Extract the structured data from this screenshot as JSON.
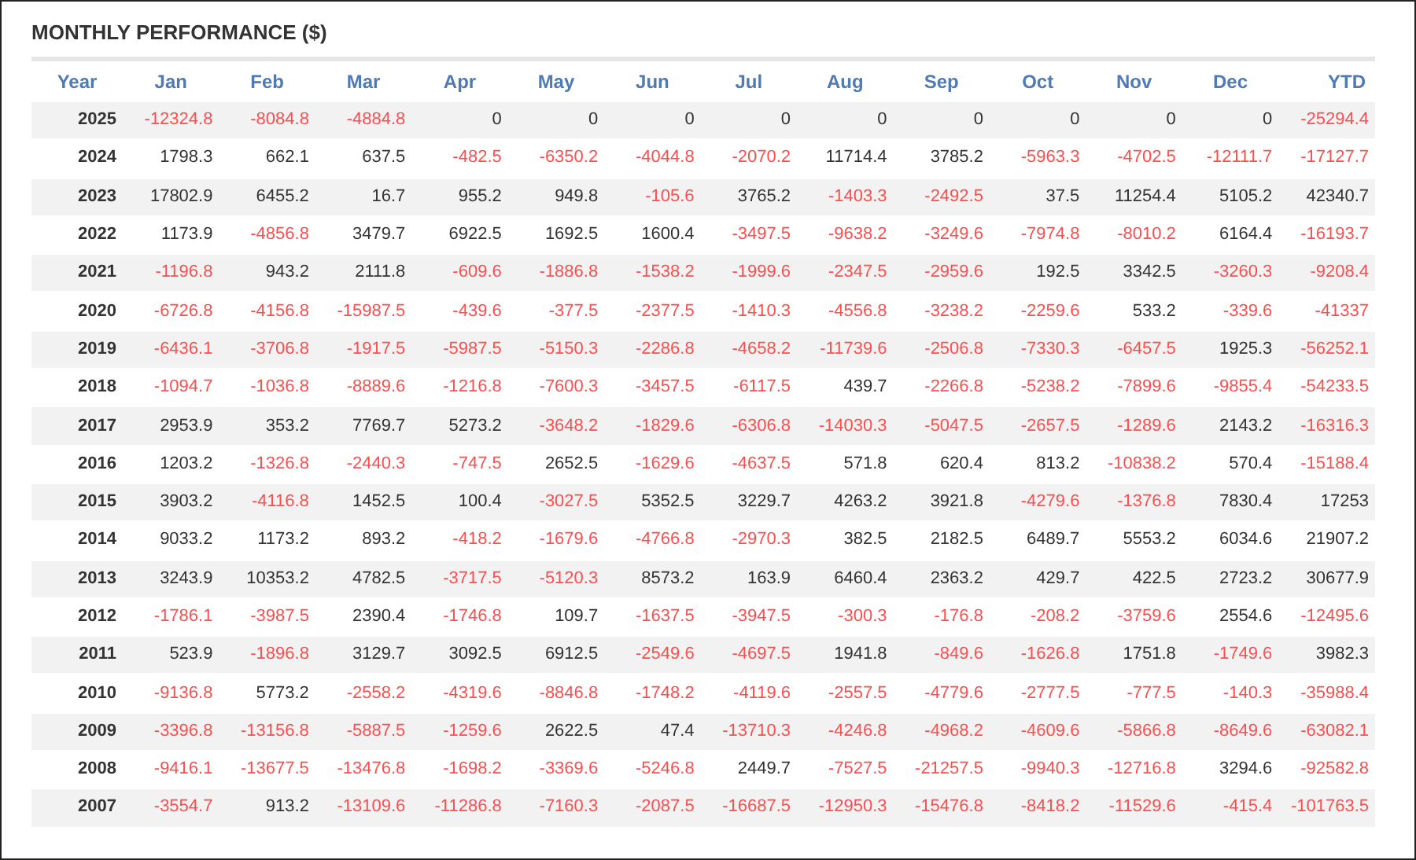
{
  "title": "MONTHLY PERFORMANCE ($)",
  "columns": [
    "Year",
    "Jan",
    "Feb",
    "Mar",
    "Apr",
    "May",
    "Jun",
    "Jul",
    "Aug",
    "Sep",
    "Oct",
    "Nov",
    "Dec",
    "YTD"
  ],
  "rows": [
    {
      "year": "2025",
      "cells": [
        {
          "value": "-12324.8",
          "negative": true
        },
        {
          "value": "-8084.8",
          "negative": true
        },
        {
          "value": "-4884.8",
          "negative": true
        },
        {
          "value": "0",
          "negative": false
        },
        {
          "value": "0",
          "negative": false
        },
        {
          "value": "0",
          "negative": false
        },
        {
          "value": "0",
          "negative": false
        },
        {
          "value": "0",
          "negative": false
        },
        {
          "value": "0",
          "negative": false
        },
        {
          "value": "0",
          "negative": false
        },
        {
          "value": "0",
          "negative": false
        },
        {
          "value": "0",
          "negative": false
        },
        {
          "value": "-25294.4",
          "negative": true
        }
      ]
    },
    {
      "year": "2024",
      "cells": [
        {
          "value": "1798.3",
          "negative": false
        },
        {
          "value": "662.1",
          "negative": false
        },
        {
          "value": "637.5",
          "negative": false
        },
        {
          "value": "-482.5",
          "negative": true
        },
        {
          "value": "-6350.2",
          "negative": true
        },
        {
          "value": "-4044.8",
          "negative": true
        },
        {
          "value": "-2070.2",
          "negative": true
        },
        {
          "value": "11714.4",
          "negative": false
        },
        {
          "value": "3785.2",
          "negative": false
        },
        {
          "value": "-5963.3",
          "negative": true
        },
        {
          "value": "-4702.5",
          "negative": true
        },
        {
          "value": "-12111.7",
          "negative": true
        },
        {
          "value": "-17127.7",
          "negative": true
        }
      ]
    },
    {
      "year": "2023",
      "cells": [
        {
          "value": "17802.9",
          "negative": false
        },
        {
          "value": "6455.2",
          "negative": false
        },
        {
          "value": "16.7",
          "negative": false
        },
        {
          "value": "955.2",
          "negative": false
        },
        {
          "value": "949.8",
          "negative": false
        },
        {
          "value": "-105.6",
          "negative": true
        },
        {
          "value": "3765.2",
          "negative": false
        },
        {
          "value": "-1403.3",
          "negative": true
        },
        {
          "value": "-2492.5",
          "negative": true
        },
        {
          "value": "37.5",
          "negative": false
        },
        {
          "value": "11254.4",
          "negative": false
        },
        {
          "value": "5105.2",
          "negative": false
        },
        {
          "value": "42340.7",
          "negative": false
        }
      ]
    },
    {
      "year": "2022",
      "cells": [
        {
          "value": "1173.9",
          "negative": false
        },
        {
          "value": "-4856.8",
          "negative": true
        },
        {
          "value": "3479.7",
          "negative": false
        },
        {
          "value": "6922.5",
          "negative": false
        },
        {
          "value": "1692.5",
          "negative": false
        },
        {
          "value": "1600.4",
          "negative": false
        },
        {
          "value": "-3497.5",
          "negative": true
        },
        {
          "value": "-9638.2",
          "negative": true
        },
        {
          "value": "-3249.6",
          "negative": true
        },
        {
          "value": "-7974.8",
          "negative": true
        },
        {
          "value": "-8010.2",
          "negative": true
        },
        {
          "value": "6164.4",
          "negative": false
        },
        {
          "value": "-16193.7",
          "negative": true
        }
      ]
    },
    {
      "year": "2021",
      "cells": [
        {
          "value": "-1196.8",
          "negative": true
        },
        {
          "value": "943.2",
          "negative": false
        },
        {
          "value": "2111.8",
          "negative": false
        },
        {
          "value": "-609.6",
          "negative": true
        },
        {
          "value": "-1886.8",
          "negative": true
        },
        {
          "value": "-1538.2",
          "negative": true
        },
        {
          "value": "-1999.6",
          "negative": true
        },
        {
          "value": "-2347.5",
          "negative": true
        },
        {
          "value": "-2959.6",
          "negative": true
        },
        {
          "value": "192.5",
          "negative": false
        },
        {
          "value": "3342.5",
          "negative": false
        },
        {
          "value": "-3260.3",
          "negative": true
        },
        {
          "value": "-9208.4",
          "negative": true
        }
      ]
    },
    {
      "year": "2020",
      "cells": [
        {
          "value": "-6726.8",
          "negative": true
        },
        {
          "value": "-4156.8",
          "negative": true
        },
        {
          "value": "-15987.5",
          "negative": true
        },
        {
          "value": "-439.6",
          "negative": true
        },
        {
          "value": "-377.5",
          "negative": true
        },
        {
          "value": "-2377.5",
          "negative": true
        },
        {
          "value": "-1410.3",
          "negative": true
        },
        {
          "value": "-4556.8",
          "negative": true
        },
        {
          "value": "-3238.2",
          "negative": true
        },
        {
          "value": "-2259.6",
          "negative": true
        },
        {
          "value": "533.2",
          "negative": false
        },
        {
          "value": "-339.6",
          "negative": true
        },
        {
          "value": "-41337",
          "negative": true
        }
      ]
    },
    {
      "year": "2019",
      "cells": [
        {
          "value": "-6436.1",
          "negative": true
        },
        {
          "value": "-3706.8",
          "negative": true
        },
        {
          "value": "-1917.5",
          "negative": true
        },
        {
          "value": "-5987.5",
          "negative": true
        },
        {
          "value": "-5150.3",
          "negative": true
        },
        {
          "value": "-2286.8",
          "negative": true
        },
        {
          "value": "-4658.2",
          "negative": true
        },
        {
          "value": "-11739.6",
          "negative": true
        },
        {
          "value": "-2506.8",
          "negative": true
        },
        {
          "value": "-7330.3",
          "negative": true
        },
        {
          "value": "-6457.5",
          "negative": true
        },
        {
          "value": "1925.3",
          "negative": false
        },
        {
          "value": "-56252.1",
          "negative": true
        }
      ]
    },
    {
      "year": "2018",
      "cells": [
        {
          "value": "-1094.7",
          "negative": true
        },
        {
          "value": "-1036.8",
          "negative": true
        },
        {
          "value": "-8889.6",
          "negative": true
        },
        {
          "value": "-1216.8",
          "negative": true
        },
        {
          "value": "-7600.3",
          "negative": true
        },
        {
          "value": "-3457.5",
          "negative": true
        },
        {
          "value": "-6117.5",
          "negative": true
        },
        {
          "value": "439.7",
          "negative": false
        },
        {
          "value": "-2266.8",
          "negative": true
        },
        {
          "value": "-5238.2",
          "negative": true
        },
        {
          "value": "-7899.6",
          "negative": true
        },
        {
          "value": "-9855.4",
          "negative": true
        },
        {
          "value": "-54233.5",
          "negative": true
        }
      ]
    },
    {
      "year": "2017",
      "cells": [
        {
          "value": "2953.9",
          "negative": false
        },
        {
          "value": "353.2",
          "negative": false
        },
        {
          "value": "7769.7",
          "negative": false
        },
        {
          "value": "5273.2",
          "negative": false
        },
        {
          "value": "-3648.2",
          "negative": true
        },
        {
          "value": "-1829.6",
          "negative": true
        },
        {
          "value": "-6306.8",
          "negative": true
        },
        {
          "value": "-14030.3",
          "negative": true
        },
        {
          "value": "-5047.5",
          "negative": true
        },
        {
          "value": "-2657.5",
          "negative": true
        },
        {
          "value": "-1289.6",
          "negative": true
        },
        {
          "value": "2143.2",
          "negative": false
        },
        {
          "value": "-16316.3",
          "negative": true
        }
      ]
    },
    {
      "year": "2016",
      "cells": [
        {
          "value": "1203.2",
          "negative": false
        },
        {
          "value": "-1326.8",
          "negative": true
        },
        {
          "value": "-2440.3",
          "negative": true
        },
        {
          "value": "-747.5",
          "negative": true
        },
        {
          "value": "2652.5",
          "negative": false
        },
        {
          "value": "-1629.6",
          "negative": true
        },
        {
          "value": "-4637.5",
          "negative": true
        },
        {
          "value": "571.8",
          "negative": false
        },
        {
          "value": "620.4",
          "negative": false
        },
        {
          "value": "813.2",
          "negative": false
        },
        {
          "value": "-10838.2",
          "negative": true
        },
        {
          "value": "570.4",
          "negative": false
        },
        {
          "value": "-15188.4",
          "negative": true
        }
      ]
    },
    {
      "year": "2015",
      "cells": [
        {
          "value": "3903.2",
          "negative": false
        },
        {
          "value": "-4116.8",
          "negative": true
        },
        {
          "value": "1452.5",
          "negative": false
        },
        {
          "value": "100.4",
          "negative": false
        },
        {
          "value": "-3027.5",
          "negative": true
        },
        {
          "value": "5352.5",
          "negative": false
        },
        {
          "value": "3229.7",
          "negative": false
        },
        {
          "value": "4263.2",
          "negative": false
        },
        {
          "value": "3921.8",
          "negative": false
        },
        {
          "value": "-4279.6",
          "negative": true
        },
        {
          "value": "-1376.8",
          "negative": true
        },
        {
          "value": "7830.4",
          "negative": false
        },
        {
          "value": "17253",
          "negative": false
        }
      ]
    },
    {
      "year": "2014",
      "cells": [
        {
          "value": "9033.2",
          "negative": false
        },
        {
          "value": "1173.2",
          "negative": false
        },
        {
          "value": "893.2",
          "negative": false
        },
        {
          "value": "-418.2",
          "negative": true
        },
        {
          "value": "-1679.6",
          "negative": true
        },
        {
          "value": "-4766.8",
          "negative": true
        },
        {
          "value": "-2970.3",
          "negative": true
        },
        {
          "value": "382.5",
          "negative": false
        },
        {
          "value": "2182.5",
          "negative": false
        },
        {
          "value": "6489.7",
          "negative": false
        },
        {
          "value": "5553.2",
          "negative": false
        },
        {
          "value": "6034.6",
          "negative": false
        },
        {
          "value": "21907.2",
          "negative": false
        }
      ]
    },
    {
      "year": "2013",
      "cells": [
        {
          "value": "3243.9",
          "negative": false
        },
        {
          "value": "10353.2",
          "negative": false
        },
        {
          "value": "4782.5",
          "negative": false
        },
        {
          "value": "-3717.5",
          "negative": true
        },
        {
          "value": "-5120.3",
          "negative": true
        },
        {
          "value": "8573.2",
          "negative": false
        },
        {
          "value": "163.9",
          "negative": false
        },
        {
          "value": "6460.4",
          "negative": false
        },
        {
          "value": "2363.2",
          "negative": false
        },
        {
          "value": "429.7",
          "negative": false
        },
        {
          "value": "422.5",
          "negative": false
        },
        {
          "value": "2723.2",
          "negative": false
        },
        {
          "value": "30677.9",
          "negative": false
        }
      ]
    },
    {
      "year": "2012",
      "cells": [
        {
          "value": "-1786.1",
          "negative": true
        },
        {
          "value": "-3987.5",
          "negative": true
        },
        {
          "value": "2390.4",
          "negative": false
        },
        {
          "value": "-1746.8",
          "negative": true
        },
        {
          "value": "109.7",
          "negative": false
        },
        {
          "value": "-1637.5",
          "negative": true
        },
        {
          "value": "-3947.5",
          "negative": true
        },
        {
          "value": "-300.3",
          "negative": true
        },
        {
          "value": "-176.8",
          "negative": true
        },
        {
          "value": "-208.2",
          "negative": true
        },
        {
          "value": "-3759.6",
          "negative": true
        },
        {
          "value": "2554.6",
          "negative": false
        },
        {
          "value": "-12495.6",
          "negative": true
        }
      ]
    },
    {
      "year": "2011",
      "cells": [
        {
          "value": "523.9",
          "negative": false
        },
        {
          "value": "-1896.8",
          "negative": true
        },
        {
          "value": "3129.7",
          "negative": false
        },
        {
          "value": "3092.5",
          "negative": false
        },
        {
          "value": "6912.5",
          "negative": false
        },
        {
          "value": "-2549.6",
          "negative": true
        },
        {
          "value": "-4697.5",
          "negative": true
        },
        {
          "value": "1941.8",
          "negative": false
        },
        {
          "value": "-849.6",
          "negative": true
        },
        {
          "value": "-1626.8",
          "negative": true
        },
        {
          "value": "1751.8",
          "negative": false
        },
        {
          "value": "-1749.6",
          "negative": true
        },
        {
          "value": "3982.3",
          "negative": false
        }
      ]
    },
    {
      "year": "2010",
      "cells": [
        {
          "value": "-9136.8",
          "negative": true
        },
        {
          "value": "5773.2",
          "negative": false
        },
        {
          "value": "-2558.2",
          "negative": true
        },
        {
          "value": "-4319.6",
          "negative": true
        },
        {
          "value": "-8846.8",
          "negative": true
        },
        {
          "value": "-1748.2",
          "negative": true
        },
        {
          "value": "-4119.6",
          "negative": true
        },
        {
          "value": "-2557.5",
          "negative": true
        },
        {
          "value": "-4779.6",
          "negative": true
        },
        {
          "value": "-2777.5",
          "negative": true
        },
        {
          "value": "-777.5",
          "negative": true
        },
        {
          "value": "-140.3",
          "negative": true
        },
        {
          "value": "-35988.4",
          "negative": true
        }
      ]
    },
    {
      "year": "2009",
      "cells": [
        {
          "value": "-3396.8",
          "negative": true
        },
        {
          "value": "-13156.8",
          "negative": true
        },
        {
          "value": "-5887.5",
          "negative": true
        },
        {
          "value": "-1259.6",
          "negative": true
        },
        {
          "value": "2622.5",
          "negative": false
        },
        {
          "value": "47.4",
          "negative": false
        },
        {
          "value": "-13710.3",
          "negative": true
        },
        {
          "value": "-4246.8",
          "negative": true
        },
        {
          "value": "-4968.2",
          "negative": true
        },
        {
          "value": "-4609.6",
          "negative": true
        },
        {
          "value": "-5866.8",
          "negative": true
        },
        {
          "value": "-8649.6",
          "negative": true
        },
        {
          "value": "-63082.1",
          "negative": true
        }
      ]
    },
    {
      "year": "2008",
      "cells": [
        {
          "value": "-9416.1",
          "negative": true
        },
        {
          "value": "-13677.5",
          "negative": true
        },
        {
          "value": "-13476.8",
          "negative": true
        },
        {
          "value": "-1698.2",
          "negative": true
        },
        {
          "value": "-3369.6",
          "negative": true
        },
        {
          "value": "-5246.8",
          "negative": true
        },
        {
          "value": "2449.7",
          "negative": false
        },
        {
          "value": "-7527.5",
          "negative": true
        },
        {
          "value": "-21257.5",
          "negative": true
        },
        {
          "value": "-9940.3",
          "negative": true
        },
        {
          "value": "-12716.8",
          "negative": true
        },
        {
          "value": "3294.6",
          "negative": false
        },
        {
          "value": "-92582.8",
          "negative": true
        }
      ]
    },
    {
      "year": "2007",
      "cells": [
        {
          "value": "-3554.7",
          "negative": true
        },
        {
          "value": "913.2",
          "negative": false
        },
        {
          "value": "-13109.6",
          "negative": true
        },
        {
          "value": "-11286.8",
          "negative": true
        },
        {
          "value": "-7160.3",
          "negative": true
        },
        {
          "value": "-2087.5",
          "negative": true
        },
        {
          "value": "-16687.5",
          "negative": true
        },
        {
          "value": "-12950.3",
          "negative": true
        },
        {
          "value": "-15476.8",
          "negative": true
        },
        {
          "value": "-8418.2",
          "negative": true
        },
        {
          "value": "-11529.6",
          "negative": true
        },
        {
          "value": "-415.4",
          "negative": true
        },
        {
          "value": "-101763.5",
          "negative": true
        }
      ]
    }
  ]
}
